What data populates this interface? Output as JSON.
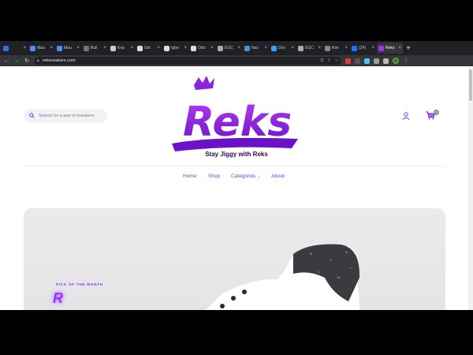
{
  "browser": {
    "tabs": [
      {
        "title": "",
        "favicon_color": "#2f6fed",
        "active": false
      },
      {
        "title": "Mau",
        "favicon_color": "#4e8cff",
        "active": false
      },
      {
        "title": "Mau",
        "favicon_color": "#4e8cff",
        "active": false
      },
      {
        "title": "Buil",
        "favicon_color": "#777777",
        "active": false
      },
      {
        "title": "Kna",
        "favicon_color": "#cccccc",
        "active": false
      },
      {
        "title": "Unt",
        "favicon_color": "#dddddd",
        "active": false
      },
      {
        "title": "Igbo",
        "favicon_color": "#dddddd",
        "active": false
      },
      {
        "title": "Odo",
        "favicon_color": "#dddddd",
        "active": false
      },
      {
        "title": "EGC",
        "favicon_color": "#aaaaaa",
        "active": false
      },
      {
        "title": "Nax",
        "favicon_color": "#4a90d9",
        "active": false
      },
      {
        "title": "Dov",
        "favicon_color": "#3aa0ff",
        "active": false
      },
      {
        "title": "EGC",
        "favicon_color": "#aaaaaa",
        "active": false
      },
      {
        "title": "Kim",
        "favicon_color": "#888888",
        "active": false
      },
      {
        "title": "(24)",
        "favicon_color": "#1877f2",
        "active": false
      },
      {
        "title": "Reks",
        "favicon_color": "#9b30ff",
        "active": true
      }
    ],
    "new_tab_label": "+",
    "url": "reksneakers.com",
    "nav": {
      "back": "←",
      "forward": "→",
      "reload": "↻"
    }
  },
  "site": {
    "search_placeholder": "Search for a pair of sneakers",
    "logo_text": "Reks",
    "tagline": "Stay Jiggy with Reks",
    "cart_count": "0",
    "nav": [
      {
        "label": "Home"
      },
      {
        "label": "Shop"
      },
      {
        "label": "Categories"
      },
      {
        "label": "About"
      }
    ],
    "hero": {
      "eyebrow": "PICK OF THE MONTH",
      "title_initial": "R"
    }
  },
  "colors": {
    "brand": "#7b2ff7",
    "brand_dark": "#2b0a4d",
    "hero_bg": "#e6e6e9"
  },
  "icons": [
    "search-icon",
    "user-icon",
    "cart-icon",
    "crown-icon",
    "chevron-down-icon"
  ]
}
